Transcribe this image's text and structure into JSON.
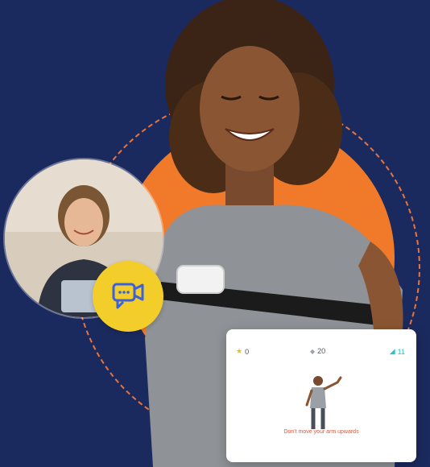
{
  "exercise_card": {
    "stars": "0",
    "points": "20",
    "extra": "11",
    "instruction": "Don't move your arm upwards"
  },
  "icons": {
    "video_call": "video-chat-icon",
    "star": "star-icon",
    "points": "gem-icon"
  },
  "colors": {
    "background": "#1b2a5e",
    "accent_orange": "#f07a2a",
    "badge_yellow": "#f3cd2a",
    "instruction_red": "#e0563a"
  }
}
